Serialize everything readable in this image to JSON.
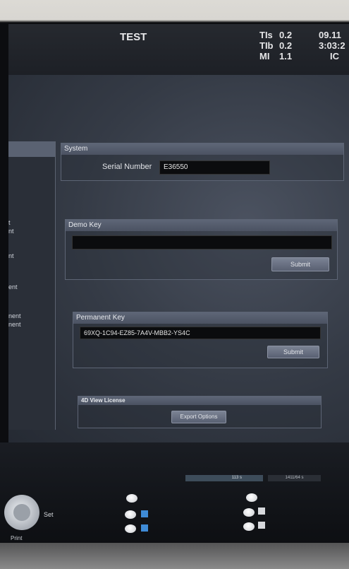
{
  "header": {
    "title": "TEST",
    "ti_labels": [
      "TIs",
      "TIb",
      "MI"
    ],
    "ti_values": [
      "0.2",
      "0.2",
      "1.1"
    ],
    "right": [
      "09.11",
      "3:03:2",
      "IC"
    ]
  },
  "left_panel": {
    "items": [
      "t",
      "nt",
      "nt",
      "ent",
      "nent",
      "nent"
    ]
  },
  "system": {
    "heading": "System",
    "serial_label": "Serial Number",
    "serial_value": "E36550"
  },
  "demo_key": {
    "heading": "Demo Key",
    "value": "",
    "submit": "Submit"
  },
  "permanent_key": {
    "heading": "Permanent Key",
    "value": "69XQ-1C94-EZ85-7A4V-MBB2-YS4C",
    "submit": "Submit"
  },
  "view_license": {
    "heading": "4D View License",
    "export": "Export Options"
  },
  "bottom": {
    "progress_label": "113 s",
    "progress2_label": "1411/64 s",
    "set": "Set",
    "print": "Print"
  }
}
